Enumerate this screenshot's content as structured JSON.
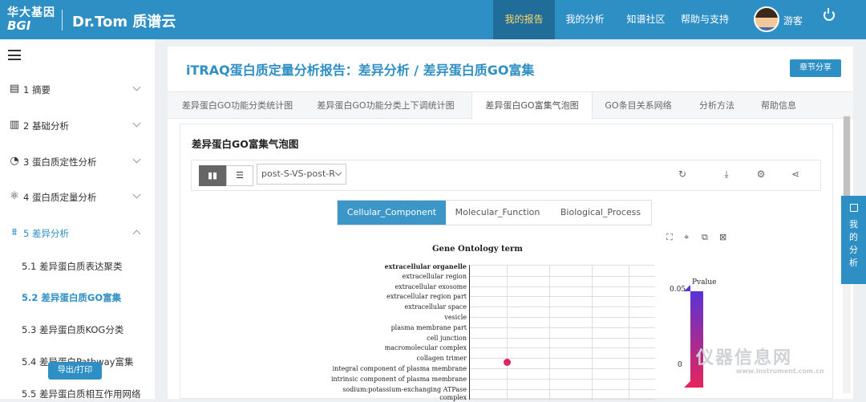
{
  "header": {
    "logo_cn": "华大基因",
    "logo_en": "BGI",
    "brand": "Dr.Tom 质谱云",
    "nav": [
      "我的报告",
      "我的分析",
      "知谱社区",
      "帮助与支持"
    ],
    "user": "游客"
  },
  "sidebar": {
    "menus": [
      {
        "label": "1 摘要",
        "icon": "document-icon"
      },
      {
        "label": "2 基础分析",
        "icon": "bar-chart-icon"
      },
      {
        "label": "3 蛋白质定性分析",
        "icon": "pie-chart-icon"
      },
      {
        "label": "4 蛋白质定量分析",
        "icon": "molecule-icon"
      },
      {
        "label": "5 差异分析",
        "icon": "diff-icon"
      }
    ],
    "submenus": [
      "5.1 差异蛋白质表达聚类",
      "5.2 差异蛋白质GO富集",
      "5.3 差异蛋白质KOG分类",
      "5.4 差异蛋白Pathway富集",
      "5.5 差异蛋白质相互作用网络"
    ],
    "export_label": "导出/打印"
  },
  "main": {
    "title": "iTRAQ蛋白质定量分析报告：差异分析 / 差异蛋白质GO富集",
    "share_label": "章节分享",
    "tabs": [
      "差异蛋白GO功能分类统计图",
      "差异蛋白GO功能分类上下调统计图",
      "差异蛋白GO富集气泡图",
      "GO条目关系网络",
      "分析方法",
      "帮助信息"
    ],
    "card_title": "差异蛋白GO富集气泡图",
    "compare_select": "post-S-VS-post-R",
    "subtabs": [
      "Cellular_Component",
      "Molecular_Function",
      "Biological_Process"
    ]
  },
  "float_panel": {
    "label": "我的分析",
    "chars": [
      "我",
      "的",
      "分",
      "析"
    ]
  },
  "watermark": {
    "text": "仪器信息网",
    "sub": "www.instrument.com.cn"
  },
  "chart_data": {
    "type": "scatter",
    "title": "Gene Ontology term",
    "terms": [
      "extracellular organelle",
      "extracellular region",
      "extracellular exosome",
      "extracellular region part",
      "extracellular space",
      "vesicle",
      "plasma membrane part",
      "cell junction",
      "macromolecular complex",
      "collagen trimer",
      "integral component of plasma membrane",
      "intrinsic component of plasma membrane",
      "sodium:potassium-exchanging ATPase complex"
    ],
    "points": [
      {
        "term": "collagen trimer",
        "pvalue": 0.0
      }
    ],
    "legend": {
      "title": "Pvalue",
      "max": "0.05",
      "min": "0",
      "color_high": "#5a33d6",
      "color_low": "#e8245a"
    }
  }
}
